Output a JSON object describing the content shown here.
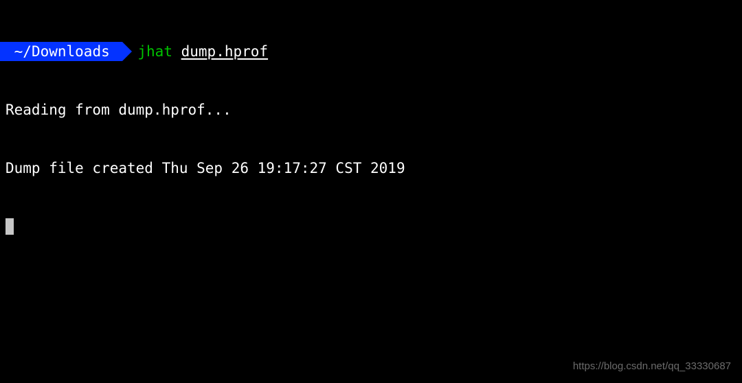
{
  "prompt": {
    "path": "~/Downloads",
    "command": "jhat",
    "argument": "dump.hprof"
  },
  "output": {
    "line1": "Reading from dump.hprof...",
    "line2": "Dump file created Thu Sep 26 19:17:27 CST 2019"
  },
  "watermark": "https://blog.csdn.net/qq_33330687"
}
